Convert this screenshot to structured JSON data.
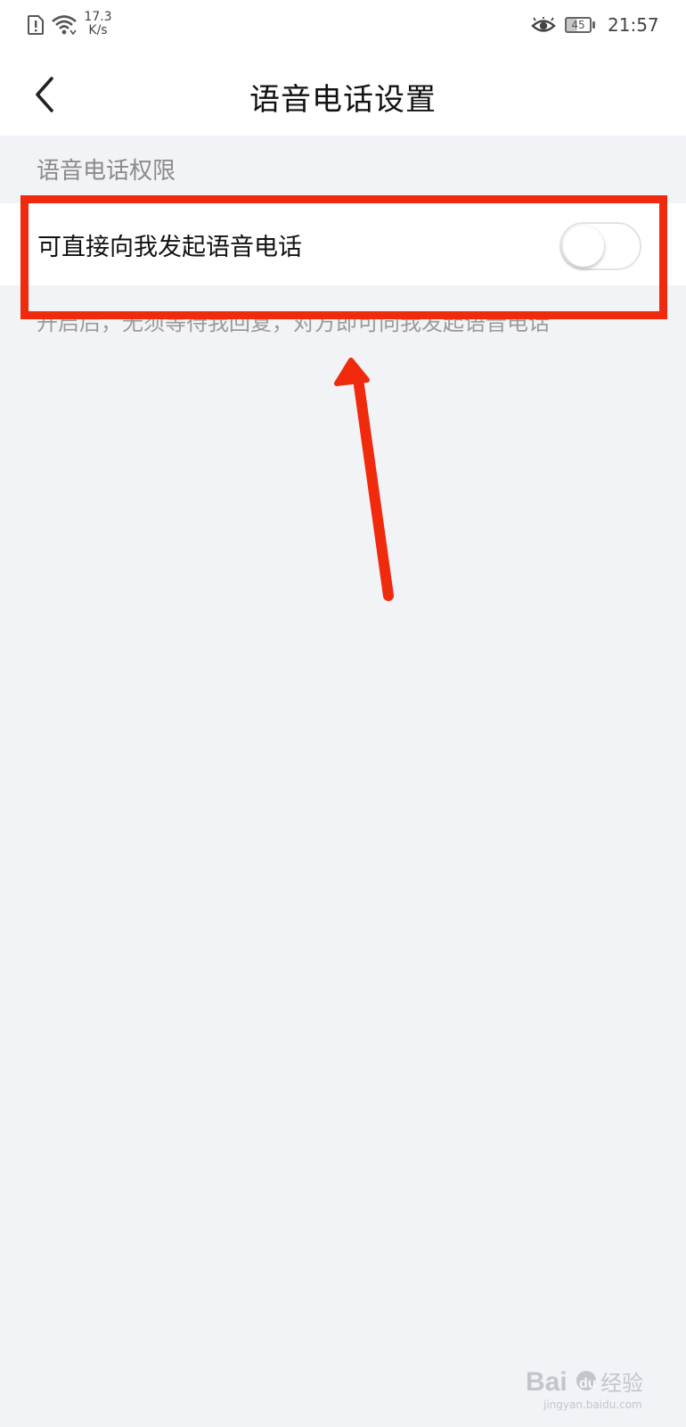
{
  "status_bar": {
    "speed_value": "17.3",
    "speed_unit": "K/s",
    "battery_level": "45",
    "time": "21:57",
    "icons": [
      "alert-card-icon",
      "wifi-icon",
      "eye-comfort-icon",
      "battery-icon"
    ]
  },
  "header": {
    "title": "语音电话设置",
    "back_icon": "chevron-left-icon"
  },
  "section": {
    "header": "语音电话权限",
    "setting": {
      "label": "可直接向我发起语音电话",
      "enabled": false
    },
    "description": "开启后，无须等待我回复，对方即可向我发起语音电话"
  },
  "watermark": {
    "text": "Baidu经验",
    "subtext": "jingyan.baidu.com"
  },
  "colors": {
    "background": "#f2f3f7",
    "card": "#ffffff",
    "annotation": "#f02a0c",
    "title": "#111111",
    "secondary": "#8a8a8e"
  }
}
